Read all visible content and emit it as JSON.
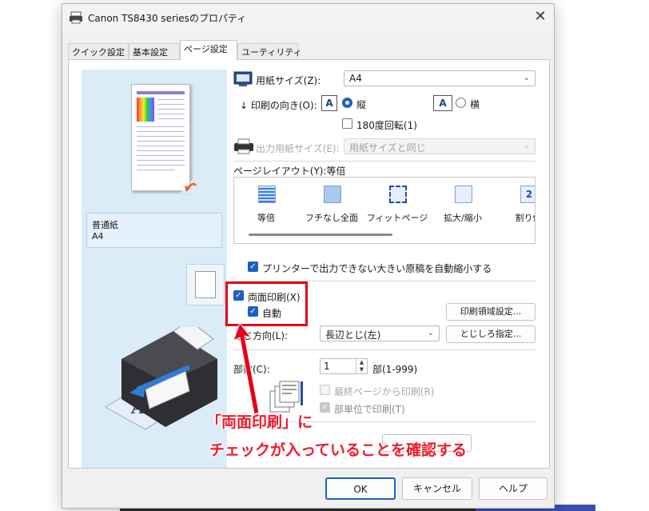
{
  "window": {
    "title": "Canon TS8430 seriesのプロパティ",
    "close_label": "✕"
  },
  "tabs": [
    {
      "label": "クイック設定",
      "active": false
    },
    {
      "label": "基本設定",
      "active": false
    },
    {
      "label": "ページ設定",
      "active": true
    },
    {
      "label": "ユーティリティ",
      "active": false
    }
  ],
  "preview": {
    "media_type": "普通紙",
    "media_size": "A4"
  },
  "page_setup": {
    "paper_size_label": "用紙サイズ(Z):",
    "paper_size_value": "A4",
    "orientation_label": "印刷の向き(O):",
    "orientation_portrait": "縦",
    "orientation_landscape": "横",
    "orientation_icon_letter": "A",
    "rotate_180_label": "180度回転(1)",
    "output_size_label": "出力用紙サイズ(E):",
    "output_size_value": "用紙サイズと同じ",
    "layout_label": "ページレイアウト(Y):等倍",
    "layout_items": [
      {
        "label": "等倍"
      },
      {
        "label": "フチなし全面"
      },
      {
        "label": "フィットページ"
      },
      {
        "label": "拡大/縮小"
      },
      {
        "label": "割り付"
      }
    ],
    "layout_last_icon_text": "2",
    "auto_reduce_label": "プリンターで出力できない大きい原稿を自動縮小する",
    "duplex_label": "両面印刷(X)",
    "auto_label": "自動",
    "print_area_button": "印刷領域設定...",
    "binding_side_label": "とじ方向(L):",
    "binding_side_value": "長辺とじ(左)",
    "binding_margin_button": "とじしろ指定...",
    "copies_label": "部数(C):",
    "copies_value": "1",
    "copies_range": "部(1-999)",
    "reverse_order_label": "最終ページから印刷(R)",
    "collate_label": "部単位で印刷(T)"
  },
  "footer": {
    "ok": "OK",
    "cancel": "キャンセル",
    "help": "ヘルプ"
  },
  "annotation": {
    "line1": "「両面印刷」に",
    "line2": "チェックが入っていることを確認する",
    "color": "#e4001b"
  }
}
